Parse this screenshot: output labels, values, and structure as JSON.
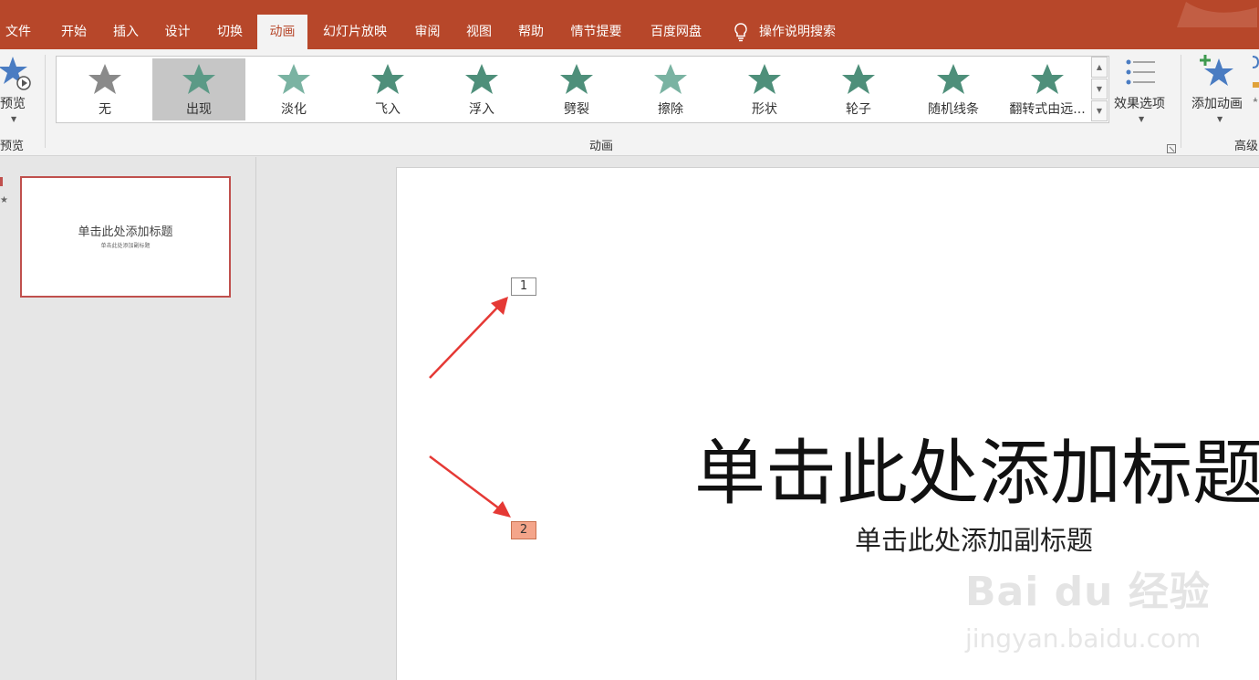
{
  "tabs": [
    "文件",
    "开始",
    "插入",
    "设计",
    "切换",
    "动画",
    "幻灯片放映",
    "审阅",
    "视图",
    "帮助",
    "情节提要",
    "百度网盘"
  ],
  "active_tab": "动画",
  "tell_me": "操作说明搜索",
  "ribbon": {
    "preview_button": "预览",
    "preview_group": "预览",
    "animation_group": "动画",
    "advanced_group": "高级",
    "effect_options": "效果选项",
    "add_animation": "添加动画",
    "gallery": [
      {
        "label": "无",
        "color": "#8a8a8a"
      },
      {
        "label": "出现",
        "color": "#5b9a86"
      },
      {
        "label": "淡化",
        "color": "#7ab3a2"
      },
      {
        "label": "飞入",
        "color": "#4e8f7a"
      },
      {
        "label": "浮入",
        "color": "#4e8f7a"
      },
      {
        "label": "劈裂",
        "color": "#4e8f7a"
      },
      {
        "label": "擦除",
        "color": "#7ab3a2"
      },
      {
        "label": "形状",
        "color": "#4e8f7a"
      },
      {
        "label": "轮子",
        "color": "#4e8f7a"
      },
      {
        "label": "随机线条",
        "color": "#4e8f7a"
      },
      {
        "label": "翻转式由远...",
        "color": "#4e8f7a"
      }
    ],
    "selected_item": "出现"
  },
  "thumbnail": {
    "title": "单击此处添加标题",
    "subtitle": "单击此处添加副标题"
  },
  "slide": {
    "title": "单击此处添加标题",
    "subtitle": "单击此处添加副标题",
    "badge_1": "1",
    "badge_2": "2"
  },
  "watermark": {
    "logo": "Bai du 经验",
    "url": "jingyan.baidu.com"
  },
  "colors": {
    "accent": "#b7472a",
    "ribbon_bg": "#f3f3f3",
    "arrow": "#e53935",
    "badge_2_fill": "#f4a58a"
  }
}
